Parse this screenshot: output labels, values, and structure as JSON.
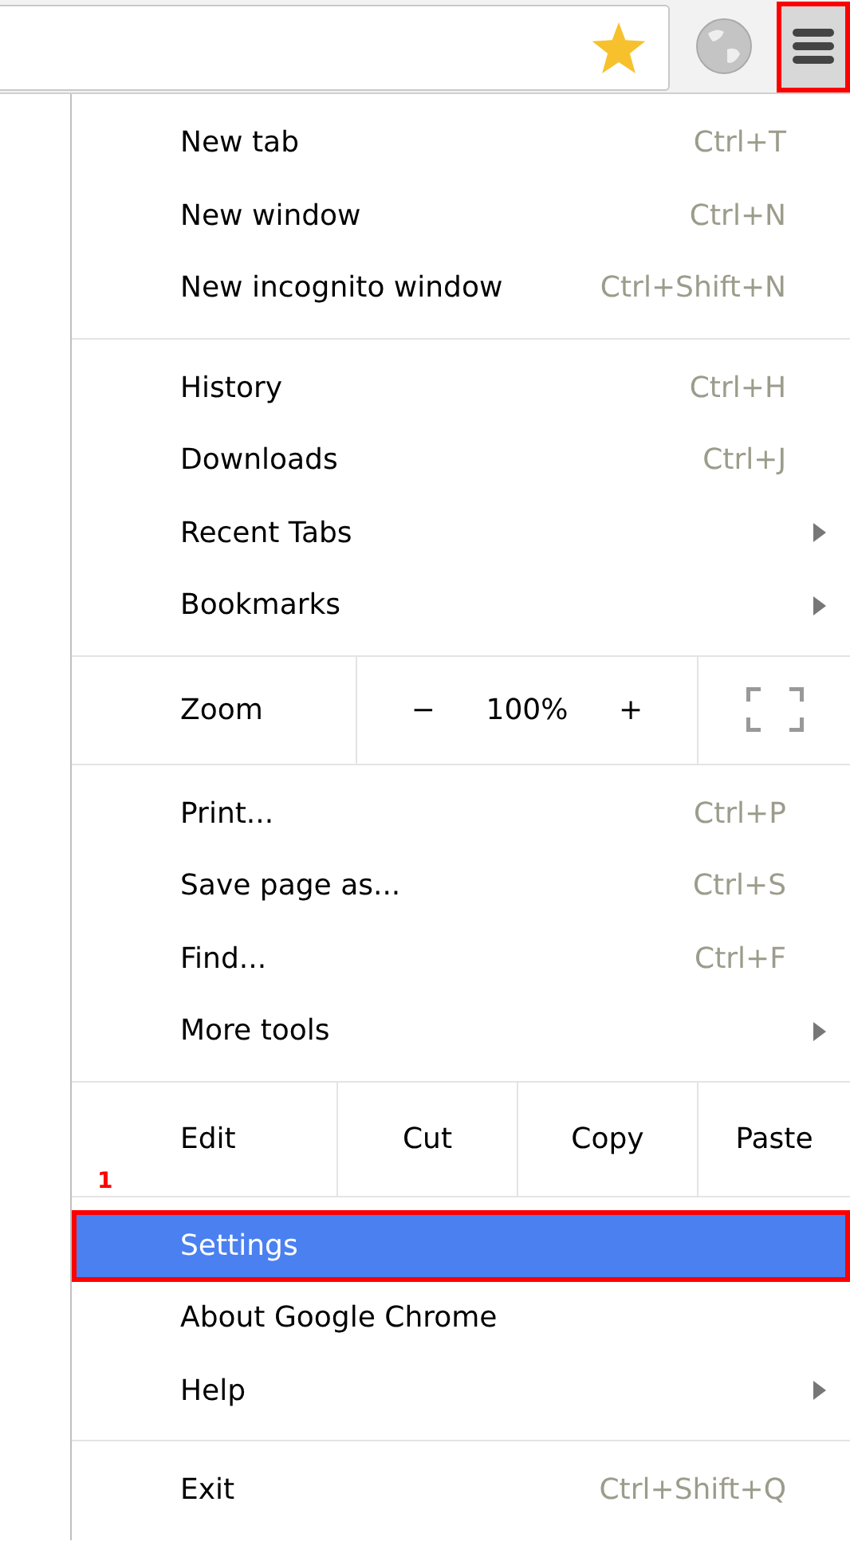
{
  "toolbar": {
    "menu_button": {
      "outlined": true
    }
  },
  "menu": {
    "sections": [
      {
        "kind": "items",
        "items": [
          {
            "label": "New tab",
            "shortcut": "Ctrl+T",
            "submenu": false,
            "selected": false,
            "outlined": false
          },
          {
            "label": "New window",
            "shortcut": "Ctrl+N",
            "submenu": false,
            "selected": false,
            "outlined": false
          },
          {
            "label": "New incognito window",
            "shortcut": "Ctrl+Shift+N",
            "submenu": false,
            "selected": false,
            "outlined": false
          }
        ]
      },
      {
        "kind": "items",
        "items": [
          {
            "label": "History",
            "shortcut": "Ctrl+H",
            "submenu": false,
            "selected": false,
            "outlined": false
          },
          {
            "label": "Downloads",
            "shortcut": "Ctrl+J",
            "submenu": false,
            "selected": false,
            "outlined": false
          },
          {
            "label": "Recent Tabs",
            "submenu": true,
            "selected": false,
            "outlined": false
          },
          {
            "label": "Bookmarks",
            "submenu": true,
            "selected": false,
            "outlined": false
          }
        ]
      },
      {
        "kind": "zoom",
        "label": "Zoom",
        "minus": "−",
        "value": "100%",
        "plus": "+"
      },
      {
        "kind": "items",
        "items": [
          {
            "label": "Print...",
            "shortcut": "Ctrl+P",
            "submenu": false,
            "selected": false,
            "outlined": false
          },
          {
            "label": "Save page as...",
            "shortcut": "Ctrl+S",
            "submenu": false,
            "selected": false,
            "outlined": false
          },
          {
            "label": "Find...",
            "shortcut": "Ctrl+F",
            "submenu": false,
            "selected": false,
            "outlined": false
          },
          {
            "label": "More tools",
            "submenu": true,
            "selected": false,
            "outlined": false
          }
        ]
      },
      {
        "kind": "edit",
        "label": "Edit",
        "buttons": [
          "Cut",
          "Copy",
          "Paste"
        ],
        "annotation": "1"
      },
      {
        "kind": "items",
        "items": [
          {
            "label": "Settings",
            "submenu": false,
            "selected": true,
            "outlined": true
          },
          {
            "label": "About Google Chrome",
            "submenu": false,
            "selected": false,
            "outlined": false
          },
          {
            "label": "Help",
            "submenu": true,
            "selected": false,
            "outlined": false
          }
        ]
      },
      {
        "kind": "items",
        "items": [
          {
            "label": "Exit",
            "shortcut": "Ctrl+Shift+Q",
            "submenu": false,
            "selected": false,
            "outlined": false
          }
        ]
      }
    ]
  }
}
